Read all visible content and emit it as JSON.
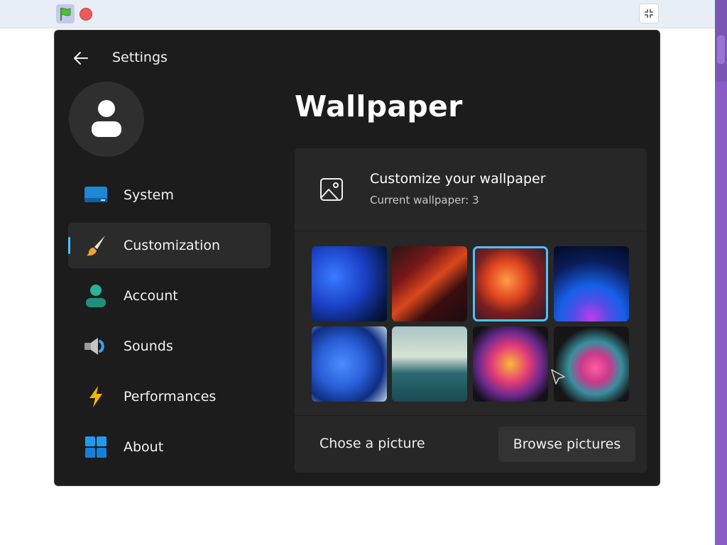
{
  "window": {
    "title": "Settings"
  },
  "sidebar": {
    "items": [
      {
        "label": "System",
        "icon": "monitor-icon"
      },
      {
        "label": "Customization",
        "icon": "paintbrush-icon",
        "active": true
      },
      {
        "label": "Account",
        "icon": "person-icon"
      },
      {
        "label": "Sounds",
        "icon": "speaker-icon"
      },
      {
        "label": "Performances",
        "icon": "lightning-icon"
      },
      {
        "label": "About",
        "icon": "windows-logo-icon"
      }
    ]
  },
  "main": {
    "title": "Wallpaper",
    "card": {
      "title": "Customize your wallpaper",
      "subtitle": "Current wallpaper: 3",
      "selected_index": 3,
      "footer_label": "Chose a picture",
      "browse_label": "Browse pictures"
    }
  },
  "colors": {
    "accent": "#4cc2ff",
    "window_bg": "#1c1c1c",
    "card_bg": "#272727",
    "scrollbar": "#8a5cc7"
  }
}
